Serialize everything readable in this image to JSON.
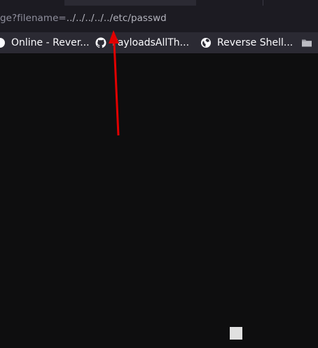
{
  "browser": {
    "url": {
      "prefix": "ge?filename=",
      "tail": "../../../../../etc/passwd"
    },
    "bookmarks": [
      {
        "label": "Online - Rever...",
        "icon": "globe-icon"
      },
      {
        "label": "PayloadsAllTh...",
        "icon": "github-icon"
      },
      {
        "label": "Reverse Shell...",
        "icon": "globe-icon"
      },
      {
        "label": "",
        "icon": "folder-icon"
      }
    ]
  },
  "annotation": {
    "color": "#e00000",
    "icon": "red-arrow-annotation"
  },
  "colors": {
    "page_background": "#0e0e0f",
    "toolbar": "#1c1b22",
    "bookmarks_bar": "#2b2a33"
  }
}
